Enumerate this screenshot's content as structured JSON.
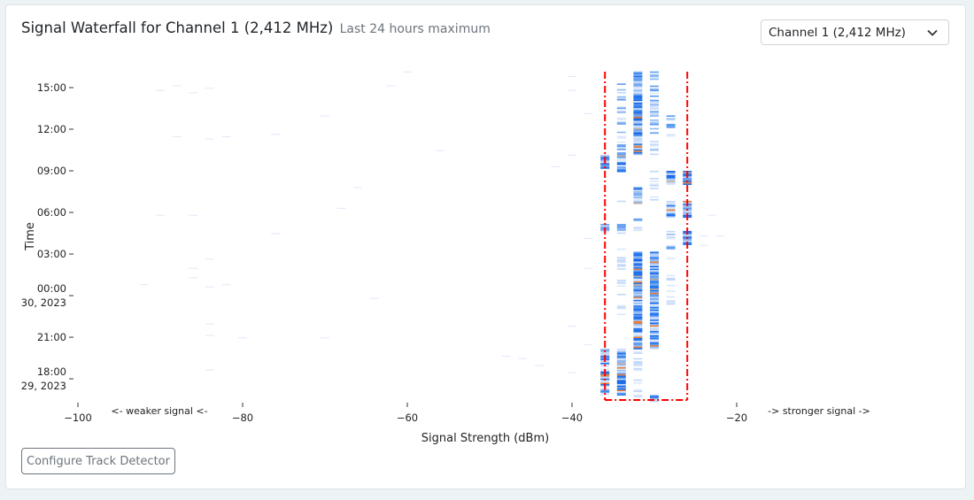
{
  "header": {
    "title": "Signal Waterfall for Channel 1 (2,412 MHz)",
    "subtitle": "Last 24 hours maximum"
  },
  "channel_select": {
    "value": "Channel 1 (2,412 MHz)",
    "icon": "chevron-down-icon"
  },
  "configure_button": "Configure Track Detector",
  "colors": {
    "low": "#dbe8fb",
    "mid": "#8fb8f2",
    "high": "#1f74ee",
    "peak": "#e27a3a",
    "detector": "#ff0000"
  },
  "chart_data": {
    "type": "heatmap",
    "xlabel": "Signal Strength (dBm)",
    "ylabel": "Time",
    "xlim": [
      -100,
      -20
    ],
    "ylim": [
      "29 16:24",
      "30 16:10"
    ],
    "x_ticks": [
      "−100",
      "−80",
      "−60",
      "−40",
      "−20"
    ],
    "x_tick_values": [
      -100,
      -80,
      -60,
      -40,
      -20
    ],
    "y_ticks": [
      {
        "label": "15:00",
        "time": "30 15:00"
      },
      {
        "label": "12:00",
        "time": "30 12:00"
      },
      {
        "label": "09:00",
        "time": "30 09:00"
      },
      {
        "label": "06:00",
        "time": "30 06:00"
      },
      {
        "label": "03:00",
        "time": "30 03:00"
      },
      {
        "label": "00:00",
        "label2": "30, 2023",
        "time": "30 00:00"
      },
      {
        "label": "21:00",
        "time": "29 21:00"
      },
      {
        "label": "18:00",
        "label2": "29, 2023",
        "time": "29 18:00"
      }
    ],
    "annotations": {
      "weaker": "<- weaker signal <-",
      "stronger": "-> stronger signal ->"
    },
    "detector_box": {
      "dbm_min": -36,
      "dbm_max": -26
    },
    "grid": false,
    "activity": [
      {
        "dbm": -36,
        "from": "30 09:10",
        "to": "30 10:10",
        "density": 0.9
      },
      {
        "dbm": -36,
        "from": "30 04:30",
        "to": "30 05:10",
        "density": 0.6
      },
      {
        "dbm": -36,
        "from": "29 16:50",
        "to": "29 20:10",
        "density": 0.9
      },
      {
        "dbm": -34,
        "from": "30 10:30",
        "to": "30 15:30",
        "density": 0.45
      },
      {
        "dbm": -34,
        "from": "30 09:00",
        "to": "30 10:20",
        "density": 0.9
      },
      {
        "dbm": -34,
        "from": "30 06:40",
        "to": "30 07:40",
        "density": 0.2
      },
      {
        "dbm": -34,
        "from": "30 04:30",
        "to": "30 05:10",
        "density": 0.8
      },
      {
        "dbm": -34,
        "from": "29 22:30",
        "to": "30 03:30",
        "density": 0.25
      },
      {
        "dbm": -34,
        "from": "29 16:50",
        "to": "29 20:10",
        "density": 0.95
      },
      {
        "dbm": -32,
        "from": "30 10:10",
        "to": "30 16:10",
        "density": 0.95
      },
      {
        "dbm": -32,
        "from": "30 06:40",
        "to": "30 07:50",
        "density": 0.95
      },
      {
        "dbm": -32,
        "from": "30 04:40",
        "to": "30 05:40",
        "density": 0.5
      },
      {
        "dbm": -32,
        "from": "29 20:10",
        "to": "30 03:10",
        "density": 0.95
      },
      {
        "dbm": -32,
        "from": "29 16:24",
        "to": "29 20:00",
        "density": 0.3
      },
      {
        "dbm": -30,
        "from": "30 10:10",
        "to": "30 16:10",
        "density": 0.6
      },
      {
        "dbm": -30,
        "from": "30 06:40",
        "to": "30 09:00",
        "density": 0.4
      },
      {
        "dbm": -30,
        "from": "29 20:10",
        "to": "30 03:10",
        "density": 0.95
      },
      {
        "dbm": -30,
        "from": "29 16:24",
        "to": "29 16:50",
        "density": 1.0
      },
      {
        "dbm": -28,
        "from": "30 11:30",
        "to": "30 13:00",
        "density": 0.6
      },
      {
        "dbm": -28,
        "from": "30 08:00",
        "to": "30 09:00",
        "density": 0.95
      },
      {
        "dbm": -28,
        "from": "30 05:40",
        "to": "30 06:50",
        "density": 0.95
      },
      {
        "dbm": -28,
        "from": "30 02:40",
        "to": "30 04:40",
        "density": 0.5
      },
      {
        "dbm": -28,
        "from": "29 23:10",
        "to": "30 02:00",
        "density": 0.2
      },
      {
        "dbm": -26,
        "from": "30 08:00",
        "to": "30 09:00",
        "density": 0.95
      },
      {
        "dbm": -26,
        "from": "30 05:40",
        "to": "30 06:50",
        "density": 0.95
      },
      {
        "dbm": -26,
        "from": "30 03:40",
        "to": "30 04:40",
        "density": 0.95
      }
    ],
    "sparse": [
      [
        -90,
        "30 14:50"
      ],
      [
        -88,
        "30 15:10"
      ],
      [
        -86,
        "30 14:40"
      ],
      [
        -84,
        "30 15:00"
      ],
      [
        -88,
        "30 11:30"
      ],
      [
        -84,
        "30 11:20"
      ],
      [
        -82,
        "30 11:30"
      ],
      [
        -90,
        "30 05:50"
      ],
      [
        -86,
        "30 05:50"
      ],
      [
        -84,
        "30 02:40"
      ],
      [
        -86,
        "30 02:00"
      ],
      [
        -86,
        "30 01:20"
      ],
      [
        -84,
        "30 00:40"
      ],
      [
        -92,
        "30 00:50"
      ],
      [
        -84,
        "29 22:00"
      ],
      [
        -84,
        "29 21:10"
      ],
      [
        -82,
        "30 00:50"
      ],
      [
        -80,
        "29 21:00"
      ],
      [
        -84,
        "29 18:40"
      ],
      [
        -76,
        "30 04:30"
      ],
      [
        -76,
        "30 11:40"
      ],
      [
        -70,
        "30 13:00"
      ],
      [
        -70,
        "29 21:00"
      ],
      [
        -68,
        "30 06:20"
      ],
      [
        -66,
        "30 07:50"
      ],
      [
        -64,
        "29 23:50"
      ],
      [
        -62,
        "30 15:10"
      ],
      [
        -60,
        "30 16:10"
      ],
      [
        -56,
        "30 10:30"
      ],
      [
        -48,
        "29 19:40"
      ],
      [
        -46,
        "29 19:30"
      ],
      [
        -44,
        "29 19:00"
      ],
      [
        -42,
        "30 09:20"
      ],
      [
        -40,
        "30 15:50"
      ],
      [
        -40,
        "30 14:50"
      ],
      [
        -40,
        "30 10:10"
      ],
      [
        -40,
        "29 21:50"
      ],
      [
        -38,
        "30 13:10"
      ],
      [
        -38,
        "30 04:10"
      ],
      [
        -38,
        "30 02:00"
      ],
      [
        -38,
        "29 20:30"
      ],
      [
        -40,
        "29 18:30"
      ],
      [
        -24,
        "30 04:20"
      ],
      [
        -24,
        "30 03:40"
      ],
      [
        -23,
        "30 05:50"
      ],
      [
        -22,
        "30 04:20"
      ]
    ]
  }
}
